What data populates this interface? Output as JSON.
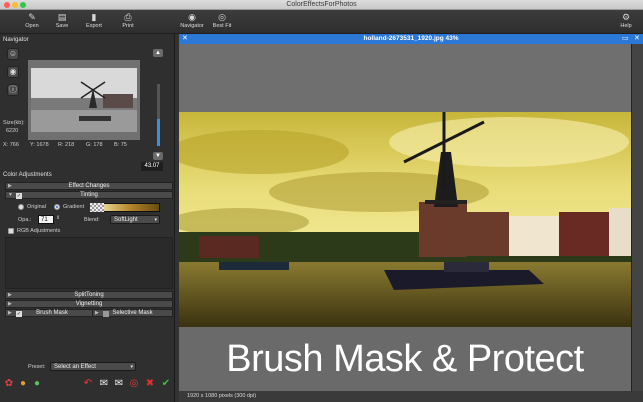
{
  "app": {
    "title": "ColorEffectsForPhotos"
  },
  "toolbar": {
    "open": "Open",
    "save": "Save",
    "export": "Export",
    "print": "Print",
    "navigator": "Navigator",
    "best_fit": "Best Fit",
    "help": "Help"
  },
  "navigator": {
    "title": "Navigator",
    "size_label": "Size(kb):",
    "size_value": "6220",
    "zoom_value": "43.07",
    "zoom_fraction": 0.43,
    "coords": {
      "x": "X: 766",
      "y": "Y: 1678",
      "r": "R: 218",
      "g": "G: 178",
      "b": "B: 75"
    }
  },
  "adjustments": {
    "title": "Color Adjustments",
    "effect_changes": "Effect Changes",
    "tinting": "Tinting",
    "original": "Original",
    "gradient": "Gradient",
    "opa_label": "Opa.:",
    "opa_value": "71",
    "blend_label": "Blend:",
    "blend_value": "SoftLight",
    "rgb_adjustments": "RGB Adjustments",
    "split_toning": "SplitToning",
    "vignetting": "Vignetting",
    "brush_mask": "Brush Mask",
    "selective_mask": "Selective Mask"
  },
  "preset": {
    "label": "Preset:",
    "value": "Select an Effect"
  },
  "image_window": {
    "title": "holland-2673531_1920.jpg 43%",
    "caption": "Brush Mask & Protect",
    "status": "1920 x 1080 pixels (300 dpi)"
  },
  "colors": {
    "accent": "#2b78d6",
    "tint": "#d8c640"
  }
}
